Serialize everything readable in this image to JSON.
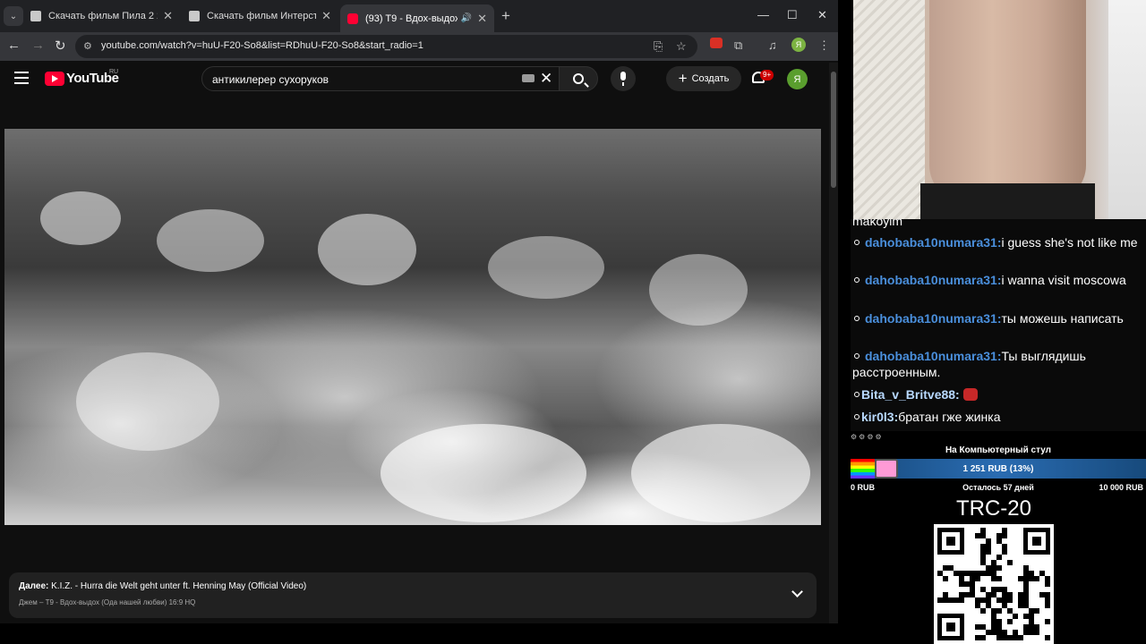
{
  "browser": {
    "tabs": [
      {
        "title": "Скачать фильм Пила 2 2005г",
        "active": false
      },
      {
        "title": "Скачать фильм Интерстеллар",
        "active": false
      },
      {
        "title": "(93) T9 - Вдох-выдох (Ода",
        "active": true
      }
    ],
    "url": "youtube.com/watch?v=huU-F20-So8&list=RDhuU-F20-So8&start_radio=1",
    "profile_initial": "Я"
  },
  "youtube": {
    "logo_text": "YouTube",
    "region": "RU",
    "search_query": "антикилерер сухоруков",
    "create_label": "Создать",
    "notifications_badge": "9+",
    "avatar_initial": "Я"
  },
  "up_next": {
    "label": "Далее:",
    "title": "K.I.Z. - Hurra die Welt geht unter ft. Henning May (Official Video)",
    "subtitle": "Джем – T9 - Вдох-выдох (Ода нашей любви) 16:9 HQ"
  },
  "chat": {
    "cut_line": "makoyim",
    "messages": [
      {
        "user": "dahobaba10numara31:",
        "text": "i guess she's not like me"
      },
      {
        "user": "dahobaba10numara31:",
        "text": "i wanna visit moscowa"
      },
      {
        "user": "dahobaba10numara31:",
        "text": "ты можешь написать"
      },
      {
        "user": "dahobaba10numara31:",
        "text": "Ты выглядишь расстроенным."
      },
      {
        "user": "Bita_v_Britve88:",
        "text": ""
      },
      {
        "user": "kir0l3:",
        "text": "братан гже жинка"
      }
    ]
  },
  "goal": {
    "title": "На Компьютерный стул",
    "current": "1 251 RUB (13%)",
    "progress": 0.13,
    "min": "0 RUB",
    "remaining": "Осталось 57 дней",
    "max": "10 000 RUB"
  },
  "wallet": {
    "label": "TRC-20"
  },
  "colors": {
    "chat_user": "#4a8fdc",
    "yt_red": "#ff0033",
    "goal_bar": "#2a6cb2"
  }
}
